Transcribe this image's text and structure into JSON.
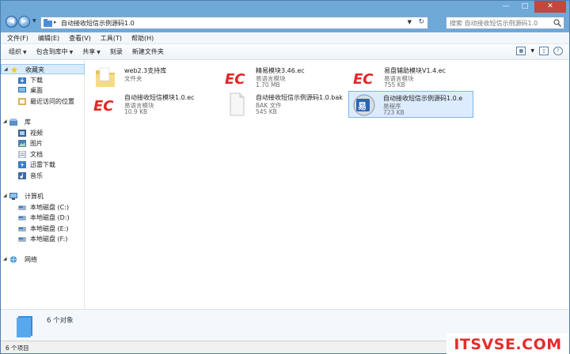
{
  "window": {
    "address_path": "自动接收短信示例源码1.0",
    "search_placeholder": "搜索 自动接收短信示例源码1.0",
    "controls": [
      "—",
      "□",
      "✕"
    ]
  },
  "menubar": [
    "文件(F)",
    "编辑(E)",
    "查看(V)",
    "工具(T)",
    "帮助(H)"
  ],
  "toolbar": {
    "organize": "组织",
    "include_in_library": "包含到库中",
    "share": "共享",
    "burn": "刻录",
    "new_folder": "新建文件夹"
  },
  "nav": {
    "favorites": "收藏夹",
    "downloads": "下载",
    "desktop": "桌面",
    "recent": "最近访问的位置",
    "libraries": "库",
    "videos": "视频",
    "pictures": "图片",
    "documents": "文档",
    "thunder": "迅雷下载",
    "music": "音乐",
    "computer": "计算机",
    "drive_c": "本地磁盘 (C:)",
    "drive_d": "本地磁盘 (D:)",
    "drive_e": "本地磁盘 (E:)",
    "drive_f": "本地磁盘 (F:)",
    "network": "网络"
  },
  "files": [
    {
      "name": "web2.3支持库",
      "type": "文件夹",
      "size": "",
      "icon": "folder-icon"
    },
    {
      "name": "精易模块3.46.ec",
      "type": "易语言模块",
      "size": "1.70 MB",
      "icon": "ec-module-icon"
    },
    {
      "name": "易盘辅助模块V1.4.ec",
      "type": "易语言模块",
      "size": "755 KB",
      "icon": "ec-module-icon"
    },
    {
      "name": "自动接收短信模块1.0.ec",
      "type": "易语言模块",
      "size": "10.9 KB",
      "icon": "ec-module-icon"
    },
    {
      "name": "自动接收短信示例源码1.0.bak",
      "type": "BAK 文件",
      "size": "545 KB",
      "icon": "blank-file-icon"
    },
    {
      "name": "自动接收短信示例源码1.0.e",
      "type": "易程序",
      "size": "723 KB",
      "icon": "e-program-icon"
    }
  ],
  "details": {
    "count": "6 个对象"
  },
  "status": {
    "items": "6 个项目"
  },
  "watermark": "ITSVSE.COM",
  "colors": {
    "chrome": "#6ea9d8",
    "selection": "#dcecfc",
    "watermark": "#e62c2c"
  }
}
